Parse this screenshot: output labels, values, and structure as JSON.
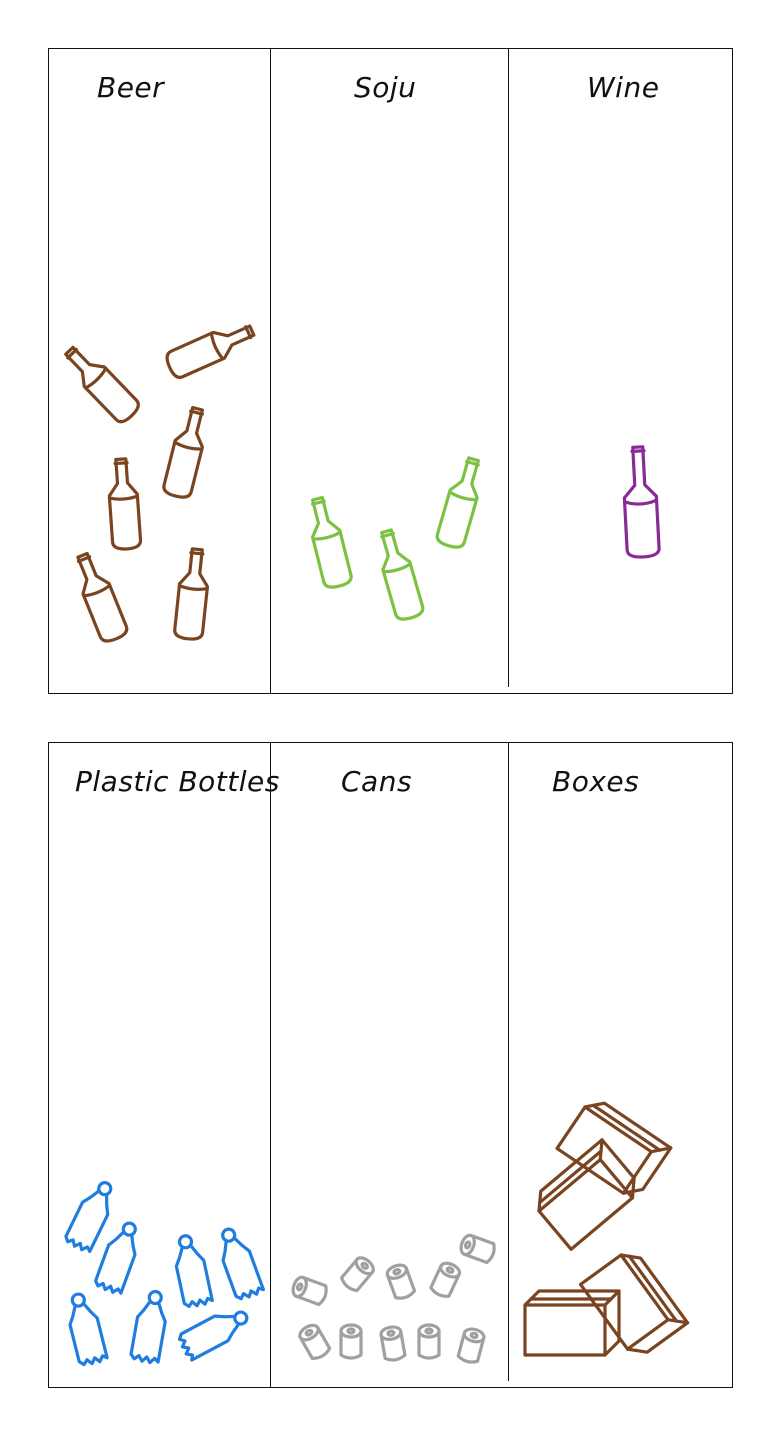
{
  "top_row": {
    "columns": [
      {
        "label": "Beer"
      },
      {
        "label": "Soju"
      },
      {
        "label": "Wine"
      }
    ]
  },
  "bottom_row": {
    "columns": [
      {
        "label": "Plastic Bottles"
      },
      {
        "label": "Cans"
      },
      {
        "label": "Boxes"
      }
    ]
  },
  "colors": {
    "beer": "#7a4420",
    "soju": "#7cc142",
    "wine": "#8a2a96",
    "plastic": "#1f7de0",
    "cans": "#a0a0a0",
    "boxes": "#7a4420",
    "line": "#111111"
  }
}
